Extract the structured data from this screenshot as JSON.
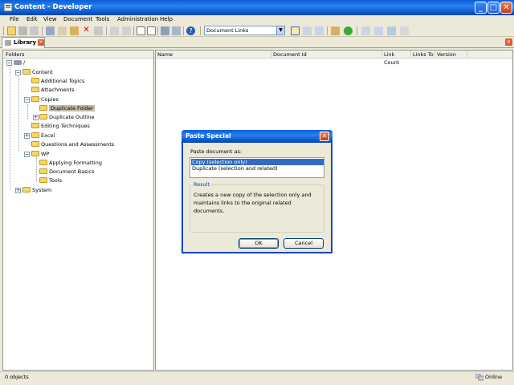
{
  "window": {
    "title": "Content - Developer",
    "minimize_label": "_",
    "maximize_label": "□",
    "close_label": "✕"
  },
  "menu": [
    {
      "label": "File"
    },
    {
      "label": "Edit"
    },
    {
      "label": "View"
    },
    {
      "label": "Document"
    },
    {
      "label": "Tools"
    },
    {
      "label": "Administration"
    },
    {
      "label": "Help"
    }
  ],
  "toolbar": {
    "view_select": "Document Links",
    "select_arrow": "▼"
  },
  "tabs": {
    "library": "Library",
    "close_label": "✕"
  },
  "folders": {
    "header": "Folders",
    "root_label": "/",
    "items": [
      {
        "label": "Content"
      },
      {
        "label": "Additional Topics"
      },
      {
        "label": "Attachments"
      },
      {
        "label": "Copies"
      },
      {
        "label": "Duplicate Folder"
      },
      {
        "label": "Duplicate Outline"
      },
      {
        "label": "Editing Techniques"
      },
      {
        "label": "Excel"
      },
      {
        "label": "Questions and Assessments"
      },
      {
        "label": "WP"
      },
      {
        "label": "Applying Formatting"
      },
      {
        "label": "Document Basics"
      },
      {
        "label": "Tools"
      },
      {
        "label": "System"
      }
    ]
  },
  "documents": {
    "columns": [
      "Name",
      "Document Id",
      "Link Count",
      "Links To",
      "Version"
    ]
  },
  "status": {
    "count": "0 objects",
    "connection": "Online"
  },
  "dialog": {
    "title": "Paste Special",
    "prompt": "Paste document as:",
    "options": [
      {
        "label": "Copy (selection only)",
        "selected": true
      },
      {
        "label": "Duplicate (selection and related)",
        "selected": false
      }
    ],
    "result_label": "Result",
    "result_text": "Creates a new copy of the selection only and maintains links to the original related documents.",
    "ok": "OK",
    "cancel": "Cancel",
    "close_label": "✕"
  },
  "colors": {
    "titlebar": "#0a5fd8",
    "selection": "#316ac5",
    "folder": "#f5d66a"
  }
}
